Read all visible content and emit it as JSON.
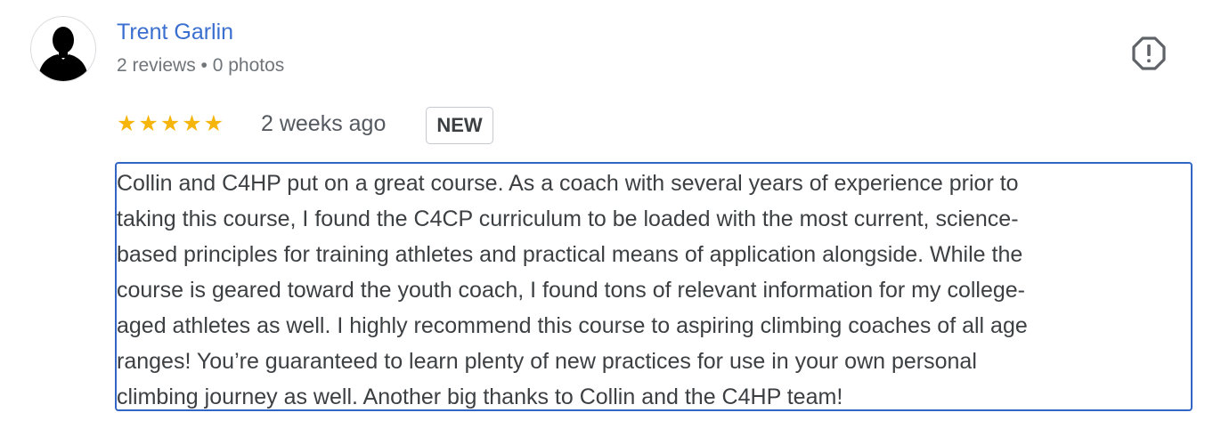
{
  "reviewer": {
    "name": "Trent Garlin",
    "meta": "2 reviews • 0 photos",
    "avatar_icon": "person-silhouette-icon"
  },
  "report_icon": "flag-report-icon",
  "rating": {
    "stars": 5,
    "stars_display": "★★★★★",
    "star_color": "#f5b50a"
  },
  "time": "2 weeks ago",
  "badge": "NEW",
  "review_lines": [
    "Collin and C4HP put on a great course. As a coach with several years of experience prior to",
    "taking this course, I found the C4CP curriculum to be loaded with the most current, science-",
    "based principles for training athletes and practical means of application alongside. While the",
    "course is geared toward the youth coach, I found tons of relevant information for my college-",
    "aged athletes as well. I highly recommend this course to aspiring climbing coaches of all age",
    "ranges! You’re guaranteed to learn plenty of new practices for use in your own personal",
    "climbing journey as well. Another big thanks to Collin and the C4HP team!"
  ],
  "colors": {
    "name": "#3a6fd0",
    "focus_border": "#3266c4"
  }
}
